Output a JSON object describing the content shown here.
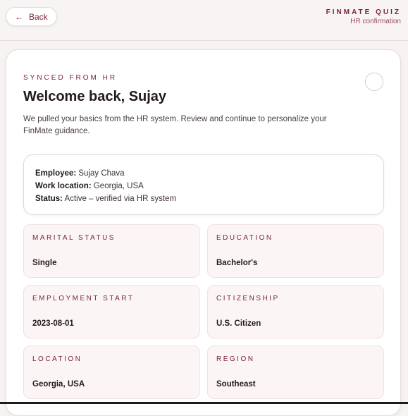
{
  "header": {
    "back_label": "Back",
    "brand_title": "FINMATE QUIZ",
    "brand_subtitle": "HR confirmation"
  },
  "card": {
    "eyebrow": "SYNCED FROM HR",
    "title": "Welcome back, Sujay",
    "intro": "We pulled your basics from the HR system. Review and continue to personalize your FinMate guidance.",
    "summary": {
      "employee_label": "Employee:",
      "employee_value": "Sujay Chava",
      "location_label": "Work location:",
      "location_value": "Georgia, USA",
      "status_label": "Status:",
      "status_value": "Active – verified via HR system"
    },
    "fields": [
      {
        "label": "MARITAL STATUS",
        "value": "Single"
      },
      {
        "label": "EDUCATION",
        "value": "Bachelor's"
      },
      {
        "label": "EMPLOYMENT START",
        "value": "2023-08-01"
      },
      {
        "label": "CITIZENSHIP",
        "value": "U.S. Citizen"
      },
      {
        "label": "LOCATION",
        "value": "Georgia, USA"
      },
      {
        "label": "REGION",
        "value": "Southeast"
      }
    ]
  },
  "colors": {
    "accent": "#7a2433",
    "field_bg": "#fbf6f5",
    "page_bg": "#f6f3f2"
  },
  "icons": {
    "back": "arrow-left-icon"
  }
}
